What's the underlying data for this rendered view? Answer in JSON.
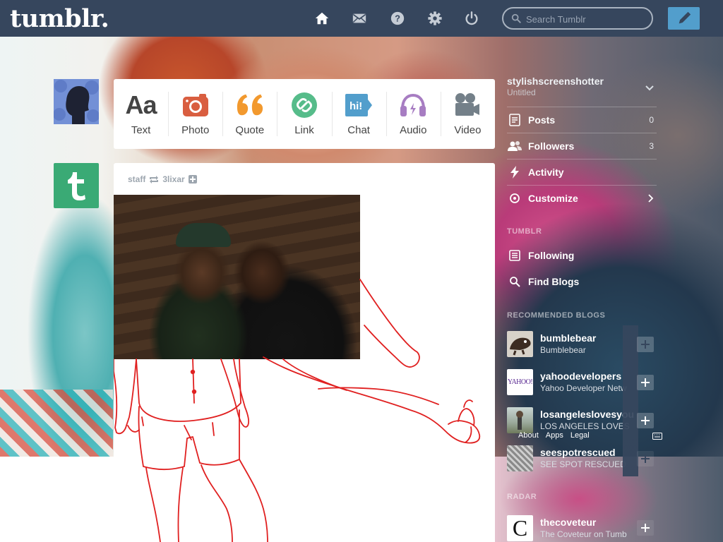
{
  "header": {
    "logo": "tumblr.",
    "search_placeholder": "Search Tumblr",
    "icons": [
      "home-icon",
      "mail-icon",
      "help-icon",
      "gear-icon",
      "power-icon",
      "search-icon",
      "pencil-icon"
    ]
  },
  "composer": {
    "types": [
      {
        "label": "Text",
        "icon": "text-icon",
        "color": "#444444",
        "glyph": "Aa"
      },
      {
        "label": "Photo",
        "icon": "camera-icon",
        "color": "#d95e40"
      },
      {
        "label": "Quote",
        "icon": "quote-icon",
        "color": "#f2992e"
      },
      {
        "label": "Link",
        "icon": "link-icon",
        "color": "#56bc8a"
      },
      {
        "label": "Chat",
        "icon": "chat-icon",
        "color": "#529ecc",
        "glyph": "hi!"
      },
      {
        "label": "Audio",
        "icon": "headphones-icon",
        "color": "#a77dc2"
      },
      {
        "label": "Video",
        "icon": "video-camera-icon",
        "color": "#748089"
      }
    ]
  },
  "post": {
    "author": "staff",
    "reblogged_from": "3lixar",
    "accent_color": "#e02020"
  },
  "sidebar": {
    "blog_name": "stylishscreenshotter",
    "blog_title": "Untitled",
    "items": [
      {
        "label": "Posts",
        "count": "0",
        "icon": "posts-icon"
      },
      {
        "label": "Followers",
        "count": "3",
        "icon": "followers-icon"
      },
      {
        "label": "Activity",
        "icon": "activity-icon"
      },
      {
        "label": "Customize",
        "icon": "customize-icon"
      }
    ],
    "section_label": "TUMBLR",
    "links": [
      {
        "label": "Following",
        "icon": "following-icon"
      },
      {
        "label": "Find Blogs",
        "icon": "find-blogs-icon"
      }
    ],
    "recommended_heading": "RECOMMENDED BLOGS",
    "recommended": [
      {
        "name": "bumblebear",
        "sub": "Bumblebear"
      },
      {
        "name": "yahoodevelopers",
        "sub": "Yahoo Developer Netw",
        "thumb_text": "YAHOO!"
      },
      {
        "name": "losangeleslovesyou",
        "sub": "LOS ANGELES LOVES"
      },
      {
        "name": "seespotrescued",
        "sub": "SEE SPOT RESCUED"
      }
    ],
    "footer_links": [
      "About",
      "Apps",
      "Legal"
    ],
    "radar_heading": "RADAR",
    "radar": {
      "name": "thecoveteur",
      "sub": "The Coveteur on Tumb",
      "thumb_text": "C"
    }
  }
}
